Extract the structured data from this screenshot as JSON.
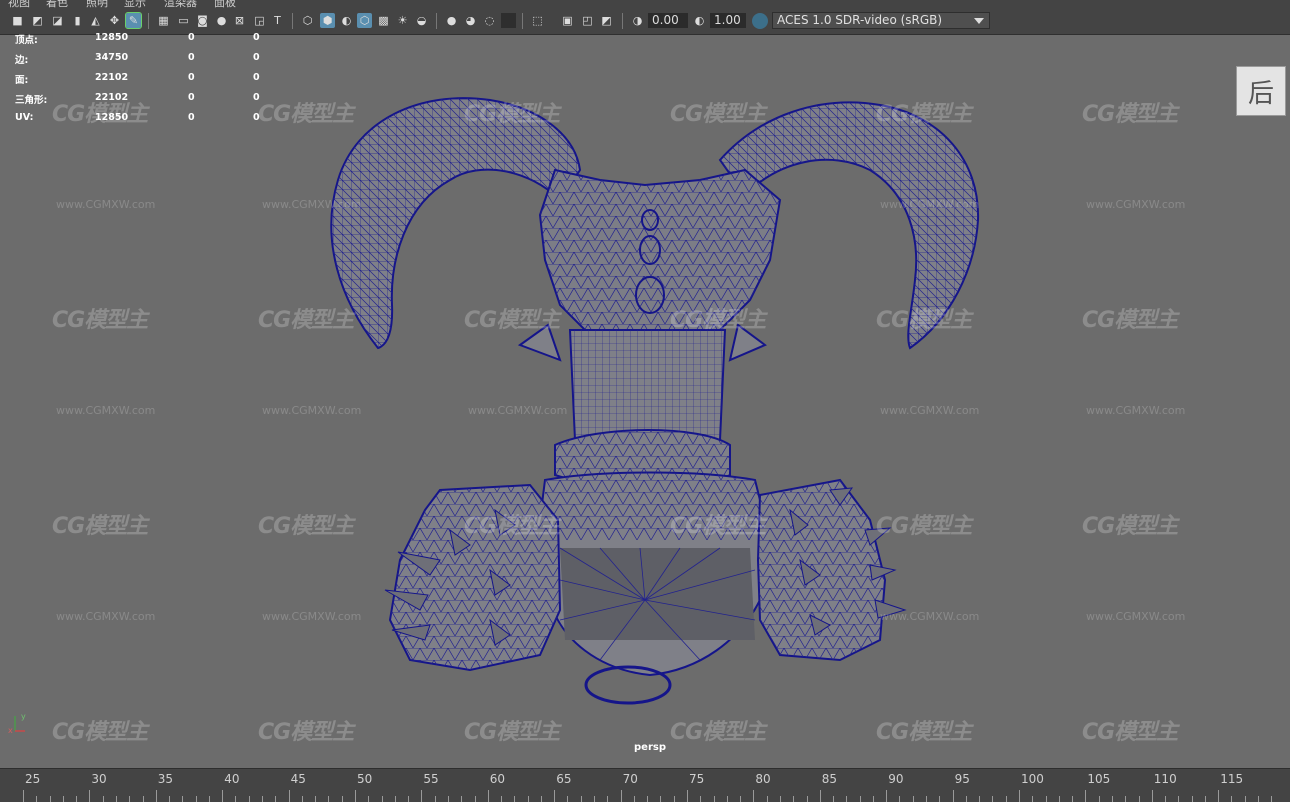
{
  "menu": [
    "视图",
    "着色",
    "照明",
    "显示",
    "渲染器",
    "面板"
  ],
  "toolbar": {
    "exposure": "0.00",
    "gamma": "1.00",
    "color_space": "ACES 1.0 SDR-video (sRGB)"
  },
  "hud": [
    {
      "label": "顶点:",
      "v1": "12850",
      "v2": "0",
      "v3": "0"
    },
    {
      "label": "边:",
      "v1": "34750",
      "v2": "0",
      "v3": "0"
    },
    {
      "label": "面:",
      "v1": "22102",
      "v2": "0",
      "v3": "0"
    },
    {
      "label": "三角形:",
      "v1": "22102",
      "v2": "0",
      "v3": "0"
    },
    {
      "label": "UV:",
      "v1": "12850",
      "v2": "0",
      "v3": "0"
    }
  ],
  "viewcube_label": "后",
  "camera_label": "persp",
  "watermark_logo": "CG模型主",
  "watermark_url": "www.CGMXW.com",
  "axis": {
    "y": "y",
    "x": "x"
  },
  "timeline_ticks": [
    "25",
    "30",
    "35",
    "40",
    "45",
    "50",
    "55",
    "60",
    "65",
    "70",
    "75",
    "80",
    "85",
    "90",
    "95",
    "100",
    "105",
    "110",
    "115"
  ],
  "colors": {
    "wire": "#1a1a8c",
    "mesh": "#7f8088",
    "viewport_bg": "#6c6c6c",
    "panel": "#444444",
    "accent": "#5a8fb0"
  }
}
